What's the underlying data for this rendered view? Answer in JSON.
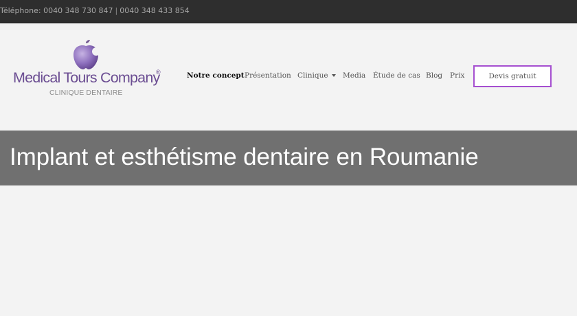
{
  "topbar": {
    "phone_1": "Téléphone: 0040 348 730 847",
    "separator": "|",
    "phone_2": "0040 348 433 854"
  },
  "logo": {
    "brand": "Medical Tours Company",
    "registered": "®",
    "subtitle": "CLINIQUE DENTAIRE",
    "icon": "apple-tooth-icon"
  },
  "nav": {
    "items": [
      {
        "label": "Notre concept",
        "active": true
      },
      {
        "label": "Présentation"
      },
      {
        "label": "Clinique",
        "has_dropdown": true
      },
      {
        "label": "Media"
      },
      {
        "label": "Étude de cas"
      },
      {
        "label": "Blog"
      },
      {
        "label": "Prix"
      }
    ],
    "cta_label": "Devis gratuit"
  },
  "banner": {
    "title": "Implant et esthétisme dentaire en Roumanie"
  },
  "colors": {
    "topbar_bg": "#2e2e2e",
    "page_bg": "#f3f3f3",
    "brand_purple": "#6b4d92",
    "cta_border": "#a54fd0",
    "banner_bg": "#707070"
  }
}
